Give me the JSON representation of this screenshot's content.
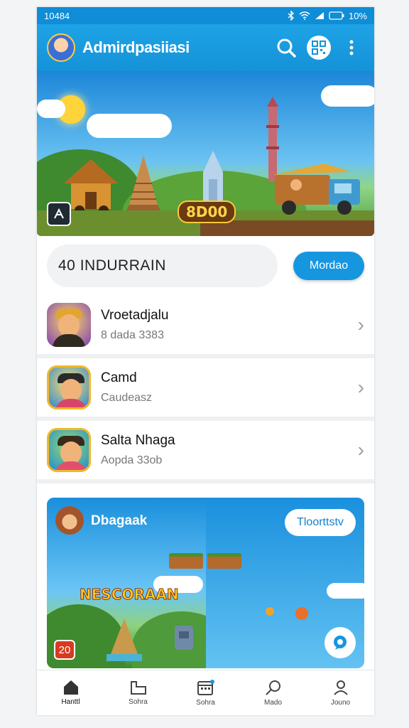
{
  "status_bar": {
    "time": "10484",
    "battery": "10%"
  },
  "app_bar": {
    "title": "Admirdpasiiasi"
  },
  "banner": {
    "price": "8D00"
  },
  "search": {
    "text": "40  INDURRAIN",
    "button_label": "Mordao"
  },
  "list": [
    {
      "title": "Vroetadjalu",
      "subtitle": "8 dada 3383"
    },
    {
      "title": "Camd",
      "subtitle": "Caudeasz"
    },
    {
      "title": "Salta Nhaga",
      "subtitle": "Aopda 33ob"
    }
  ],
  "feature": {
    "title": "Dbagaak",
    "button_label": "Tloorttstv",
    "logo_text": "NESCORAAN",
    "badge": "20"
  },
  "nav": [
    {
      "label": "Hanttl",
      "icon": "home-icon"
    },
    {
      "label": "Sohra",
      "icon": "folder-icon"
    },
    {
      "label": "Sohra",
      "icon": "calendar-icon"
    },
    {
      "label": "Mado",
      "icon": "search-icon"
    },
    {
      "label": "Jouno",
      "icon": "profile-icon"
    }
  ],
  "colors": {
    "primary": "#1592d8",
    "accent": "#1796e0"
  }
}
